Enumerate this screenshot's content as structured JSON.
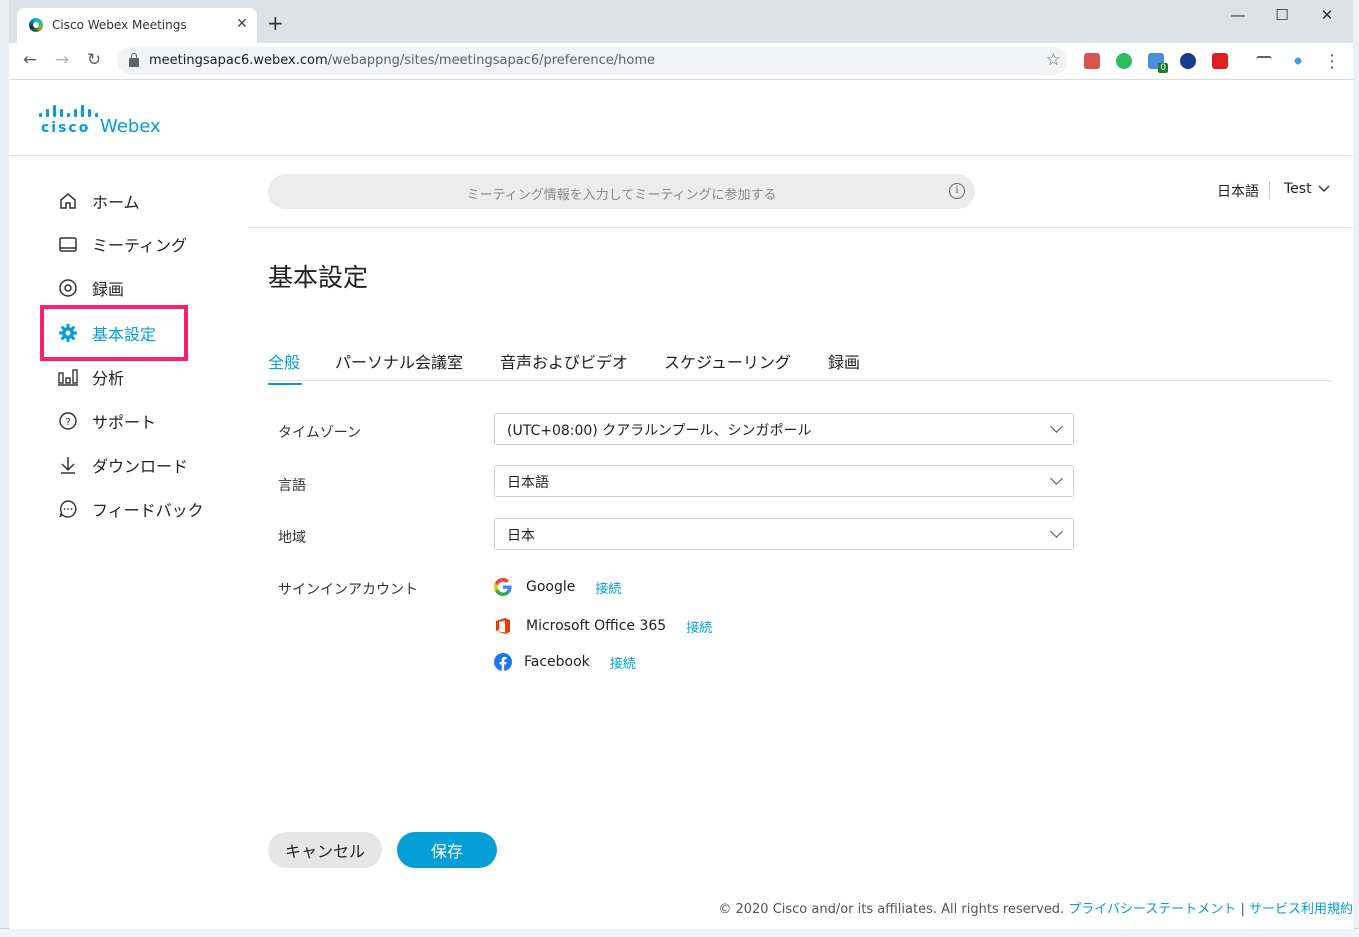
{
  "browser": {
    "tab_title": "Cisco Webex Meetings",
    "tab_close": "✕",
    "new_tab": "+",
    "url_host": "meetingsapac6.webex.com",
    "url_path": "/webappng/sites/meetingsapac6/preference/home",
    "window_controls": {
      "minimize": "—",
      "maximize": "☐",
      "close": "✕"
    },
    "extension_badge": "0"
  },
  "brand": {
    "cisco": "cisco",
    "product": "Webex"
  },
  "sidebar": {
    "items": [
      {
        "label": "ホーム",
        "icon": "home-icon"
      },
      {
        "label": "ミーティング",
        "icon": "meetings-icon"
      },
      {
        "label": "録画",
        "icon": "recording-icon"
      },
      {
        "label": "基本設定",
        "icon": "gear-icon",
        "active": true
      },
      {
        "label": "分析",
        "icon": "analytics-icon"
      },
      {
        "label": "サポート",
        "icon": "help-icon"
      },
      {
        "label": "ダウンロード",
        "icon": "download-icon"
      },
      {
        "label": "フィードバック",
        "icon": "feedback-icon"
      }
    ]
  },
  "header": {
    "search_placeholder": "ミーティング情報を入力してミーティングに参加する",
    "language": "日本語",
    "user": "Test"
  },
  "page": {
    "title": "基本設定",
    "tabs": [
      "全般",
      "パーソナル会議室",
      "音声およびビデオ",
      "スケジューリング",
      "録画"
    ],
    "active_tab": "全般",
    "form": {
      "timezone_label": "タイムゾーン",
      "timezone_value": "(UTC+08:00) クアラルンプール、シンガポール",
      "language_label": "言語",
      "language_value": "日本語",
      "region_label": "地域",
      "region_value": "日本",
      "accounts_label": "サインインアカウント",
      "accounts": [
        {
          "name": "Google",
          "action": "接続",
          "icon": "google-icon"
        },
        {
          "name": "Microsoft Office 365",
          "action": "接続",
          "icon": "office365-icon"
        },
        {
          "name": "Facebook",
          "action": "接続",
          "icon": "facebook-icon"
        }
      ]
    },
    "buttons": {
      "cancel": "キャンセル",
      "save": "保存"
    }
  },
  "footer": {
    "copyright": "© 2020 Cisco and/or its affiliates. All rights reserved.",
    "privacy": "プライバシーステートメント",
    "separator": "|",
    "terms": "サービス利用規約"
  },
  "colors": {
    "accent": "#049fd9",
    "highlight": "#ff1f6e"
  }
}
